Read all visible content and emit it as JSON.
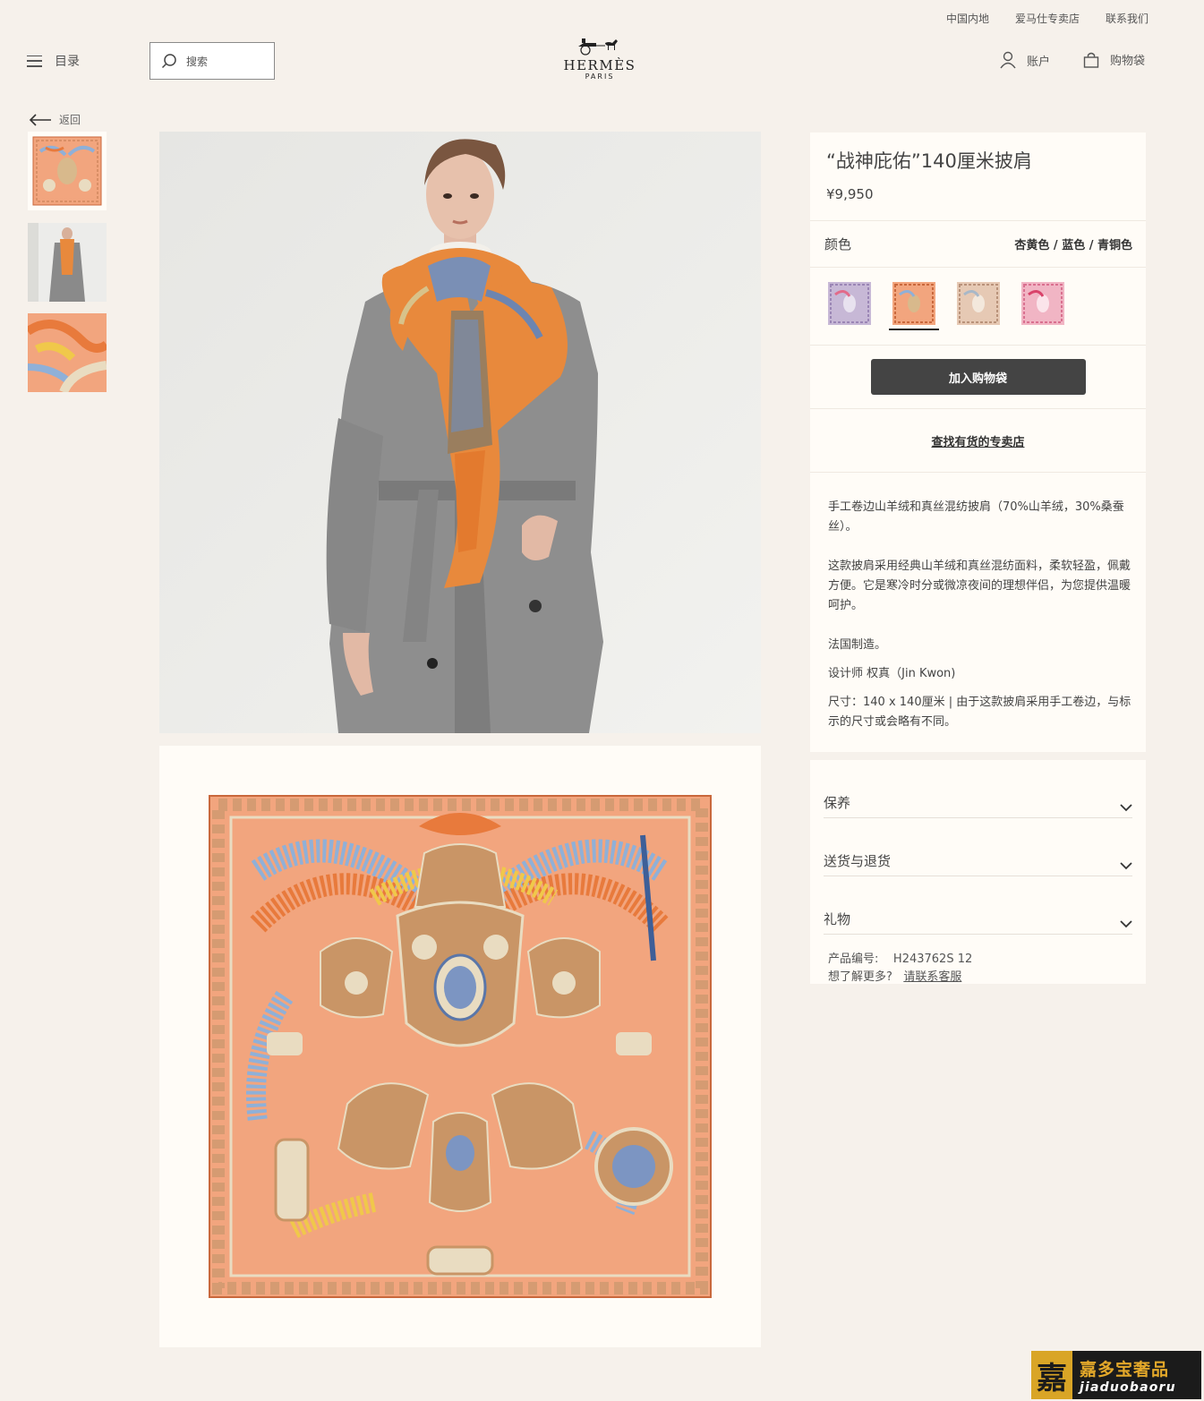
{
  "topbar": {
    "links": [
      "中国内地",
      "爱马仕专卖店",
      "联系我们"
    ]
  },
  "header": {
    "menu_label": "目录",
    "search_placeholder": "搜索",
    "brand": "HERMÈS",
    "brand_city": "PARIS",
    "account_label": "账户",
    "bag_label": "购物袋"
  },
  "nav": {
    "back_label": "返回"
  },
  "product": {
    "title": "“战神庇佑”140厘米披肩",
    "price": "¥9,950",
    "color_label": "颜色",
    "color_value": "杏黄色 / 蓝色 / 青铜色",
    "swatches": [
      "#a99bbf",
      "#e7a77c",
      "#e0bfa6",
      "#e89bb0"
    ],
    "selected_swatch": 1,
    "add_to_cart": "加入购物袋",
    "find_store": "查找有货的专卖店",
    "description": [
      "手工卷边山羊绒和真丝混纺披肩（70%山羊绒，30%桑蚕丝）。",
      "这款披肩采用经典山羊绒和真丝混纺面料，柔软轻盈，佩戴方便。它是寒冷时分或微凉夜间的理想伴侣，为您提供温暖呵护。",
      "法国制造。",
      "设计师 权真（Jin Kwon)",
      "尺寸：140 x 140厘米 | 由于这款披肩采用手工卷边，与标示的尺寸或会略有不同。"
    ],
    "accordions": [
      "保养",
      "送货与退货",
      "礼物"
    ],
    "sku_label": "产品编号:",
    "sku": "H243762S 12",
    "more_label": "想了解更多?",
    "contact_link": "请联系客服"
  },
  "watermark": {
    "seal": "嘉",
    "cn": "嘉多宝奢品",
    "en": "jiaduobaoru"
  },
  "colors": {
    "bg": "#f6f1eb",
    "panel": "#fffcf7",
    "button": "#444444",
    "scarf_ground": "#f2a57e",
    "scarf_orange": "#e87a3c",
    "scarf_blue": "#8fb0d8",
    "scarf_yellow": "#f0c84a"
  }
}
